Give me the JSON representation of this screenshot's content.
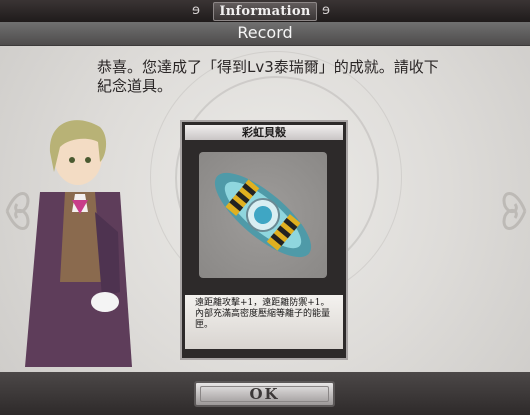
{
  "header": {
    "title": "Information",
    "left_ornament": "ornament-icon",
    "right_ornament": "ornament-icon"
  },
  "subheader": {
    "label": "Record"
  },
  "message": {
    "line1": "恭喜。您達成了「得到Lv3泰瑞爾」的成就。請收下",
    "line2": "紀念道具。"
  },
  "item_card": {
    "name": "彩虹貝殼",
    "description": "遠距離攻擊+1，遠距離防禦+1。內部充滿高密度壓縮等離子的能量匣。",
    "art_icon": "rainbow-shell-capsule-icon"
  },
  "character": {
    "icon": "character-portrait-icon"
  },
  "footer": {
    "ok_label": "OK"
  },
  "colors": {
    "accent": "#5fb8c8",
    "stripe_yellow": "#e0b020",
    "frame": "#2d2a2a"
  }
}
